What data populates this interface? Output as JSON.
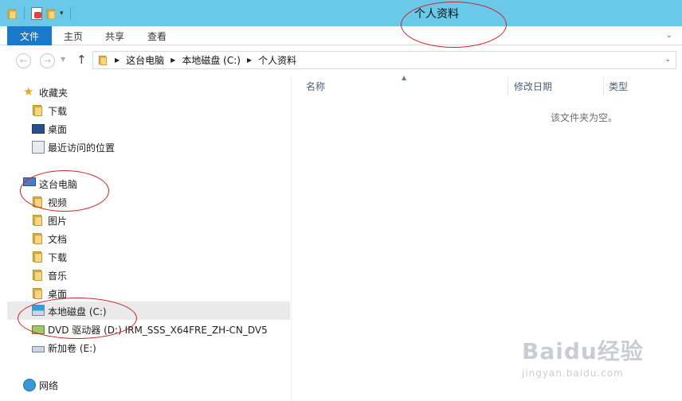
{
  "window": {
    "title": "个人资料"
  },
  "ribbon": {
    "tabs": [
      "文件",
      "主页",
      "共享",
      "查看"
    ]
  },
  "address": {
    "crumbs": [
      "这台电脑",
      "本地磁盘 (C:)",
      "个人资料"
    ]
  },
  "nav": {
    "favorites": {
      "label": "收藏夹",
      "items": [
        "下载",
        "桌面",
        "最近访问的位置"
      ]
    },
    "this_pc": {
      "label": "这台电脑",
      "items": [
        "视频",
        "图片",
        "文档",
        "下载",
        "音乐",
        "桌面",
        "本地磁盘 (C:)",
        "DVD 驱动器 (D:) IRM_SSS_X64FRE_ZH-CN_DV5",
        "新加卷 (E:)"
      ]
    },
    "network": {
      "label": "网络"
    },
    "selected": "本地磁盘 (C:)"
  },
  "content": {
    "columns": [
      "名称",
      "修改日期",
      "类型"
    ],
    "empty_message": "该文件夹为空。"
  },
  "watermark": {
    "logo": "Baidu经验",
    "url": "jingyan.baidu.com"
  },
  "colors": {
    "titlebar": "#6ac9e8",
    "file_tab": "#1979ca",
    "annotation": "#d0202a",
    "selected_row": "#eaeaea"
  }
}
